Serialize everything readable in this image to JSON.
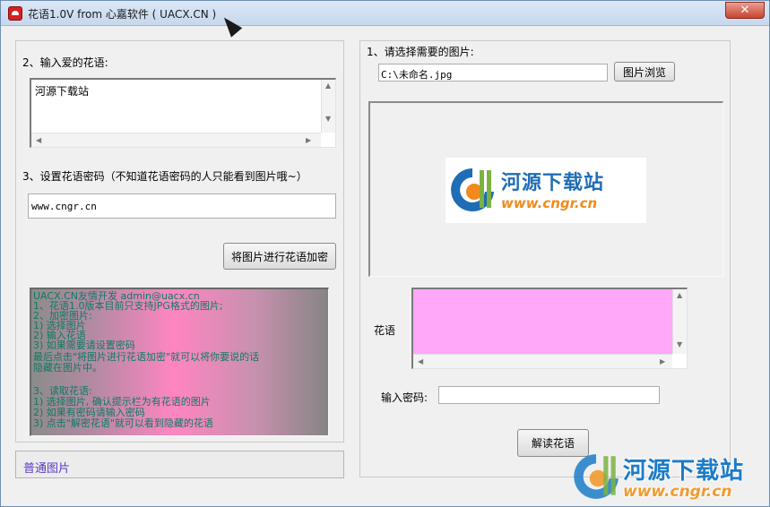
{
  "window": {
    "title": "花语1.0V from 心嘉软件 ( UACX.CN )",
    "close_symbol": "✕",
    "minimize_symbol": "",
    "maximize_symbol": ""
  },
  "left": {
    "step2_label": "2、输入爱的花语:",
    "love_text": "河源下载站",
    "step3_label": "3、设置花语密码（不知道花语密码的人只能看到图片哦~）",
    "password_value": "www.cngr.cn",
    "encrypt_button": "将图片进行花语加密",
    "info_lines": [
      "UACX.CN友情开发  admin@uacx.cn",
      "1、花语1.0版本目前只支持JPG格式的图片;",
      "2、加密图片:",
      "   1) 选择图片",
      "   2) 输入花语",
      "   3) 如果需要请设置密码",
      "      最后点击\"将图片进行花语加密\"就可以将你要说的话",
      "隐藏在图片中。",
      "",
      "3、读取花语:",
      "   1) 选择图片, 确认提示栏为有花语的图片",
      "   2) 如果有密码请输入密码",
      "   3) 点击\"解密花语\"就可以看到隐藏的花语"
    ],
    "status_text": "普通图片"
  },
  "right": {
    "step1_label": "1、请选择需要的图片:",
    "file_path": "C:\\未命名.jpg",
    "browse_button": "图片浏览",
    "preview_logo_title": "河源下载站",
    "preview_logo_url": "www.cngr.cn",
    "hua_label": "花语",
    "password_label": "输入密码:",
    "password_input": "",
    "decrypt_button": "解读花语"
  },
  "watermark": {
    "title": "河源下载站",
    "url": "www.cngr.cn"
  },
  "colors": {
    "hua_area": "#ffa7f9",
    "status_text": "#5b3bc2",
    "info_text": "#0e7a63",
    "logo_blue": "#1f6db5",
    "logo_orange": "#f08a1c"
  }
}
